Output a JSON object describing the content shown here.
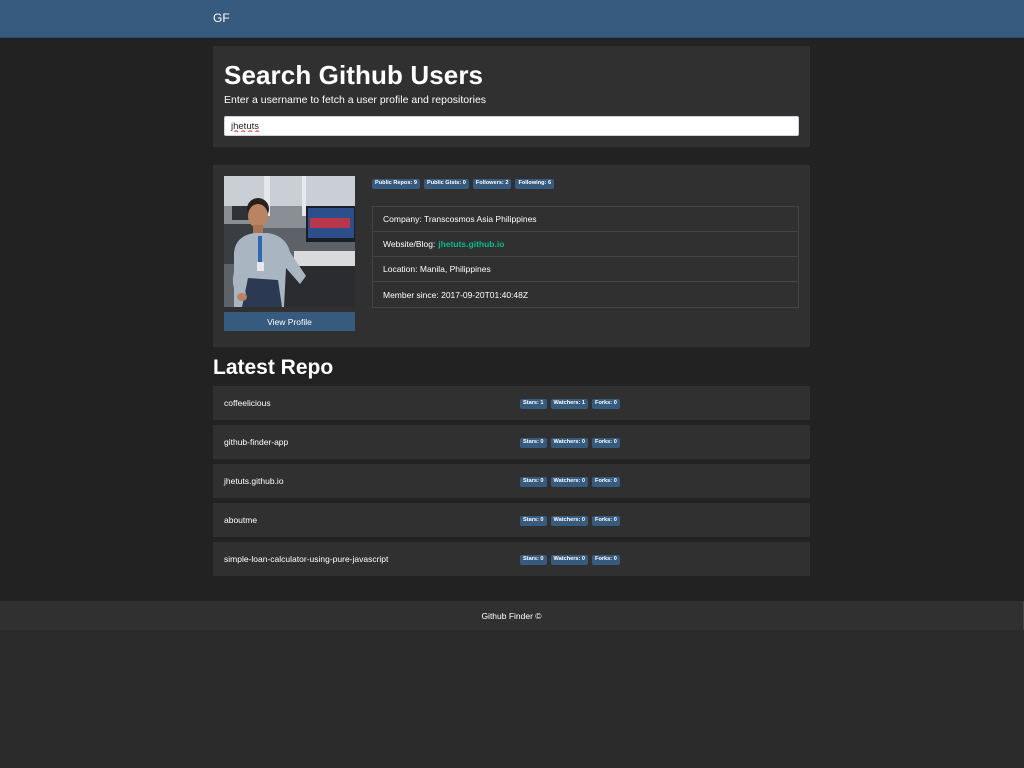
{
  "navbar": {
    "brand": "GF"
  },
  "search": {
    "title": "Search Github Users",
    "subtitle": "Enter a username to fetch a user profile and repositories",
    "value": "jhetuts"
  },
  "profile": {
    "view_profile_label": "View Profile",
    "badges": [
      {
        "label": "Public Repos: 9"
      },
      {
        "label": "Public Gists: 0"
      },
      {
        "label": "Followers: 2"
      },
      {
        "label": "Following: 6"
      }
    ],
    "company": "Company: Transcosmos Asia Philippines",
    "website_label": "Website/Blog:",
    "website_value": "jhetuts.github.io",
    "location": "Location: Manila, Philippines",
    "member_since": "Member since: 2017-09-20T01:40:48Z"
  },
  "repos": {
    "heading": "Latest Repo",
    "items": [
      {
        "name": "coffeelicious",
        "stars": "Stars: 1",
        "watchers": "Watchers: 1",
        "forks": "Forks: 0"
      },
      {
        "name": "github-finder-app",
        "stars": "Stars: 0",
        "watchers": "Watchers: 0",
        "forks": "Forks: 0"
      },
      {
        "name": "jhetuts.github.io",
        "stars": "Stars: 0",
        "watchers": "Watchers: 0",
        "forks": "Forks: 0"
      },
      {
        "name": "aboutme",
        "stars": "Stars: 0",
        "watchers": "Watchers: 0",
        "forks": "Forks: 0"
      },
      {
        "name": "simple-loan-calculator-using-pure-javascript",
        "stars": "Stars: 0",
        "watchers": "Watchers: 0",
        "forks": "Forks: 0"
      }
    ]
  },
  "footer": {
    "text": "Github Finder ©"
  },
  "colors": {
    "navbar": "#375a7f",
    "page_bg": "#222222",
    "card_bg": "#303030",
    "badge_bg": "#375a7f",
    "link": "#00bc8c"
  }
}
